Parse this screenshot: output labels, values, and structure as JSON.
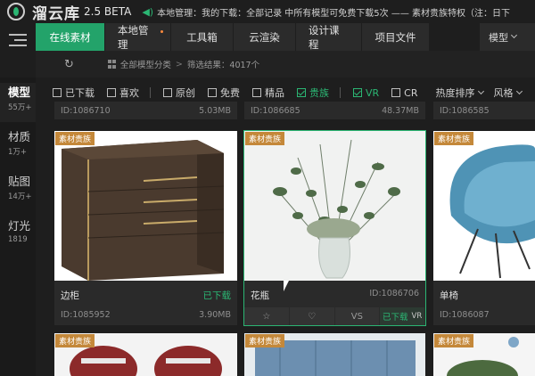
{
  "app": {
    "name": "溜云库",
    "version": "2.5 BETA"
  },
  "notice": "本地管理：我的下载：全部记录 中所有模型可免费下载5次 —— 素材贵族特权（注：日下",
  "tabs": [
    {
      "label": "在线素材",
      "active": true
    },
    {
      "label": "本地管理",
      "dot": true
    },
    {
      "label": "工具箱"
    },
    {
      "label": "云渲染"
    },
    {
      "label": "设计课程"
    },
    {
      "label": "项目文件"
    }
  ],
  "model_select": "模型",
  "crumbs": {
    "category": "全部模型分类",
    "result_label": "筛选结果：",
    "result_count": "4017个"
  },
  "sidebar": [
    {
      "label": "模型",
      "count": "55万+",
      "active": true
    },
    {
      "label": "材质",
      "count": "1万+"
    },
    {
      "label": "贴图",
      "count": "14万+"
    },
    {
      "label": "灯光",
      "count": "1819"
    }
  ],
  "filters": [
    {
      "label": "已下载",
      "checked": false
    },
    {
      "label": "喜欢",
      "checked": false
    },
    {
      "label": "原创",
      "checked": false
    },
    {
      "label": "免费",
      "checked": false
    },
    {
      "label": "精品",
      "checked": false
    },
    {
      "label": "贵族",
      "checked": true
    },
    {
      "label": "VR",
      "checked": true
    },
    {
      "label": "CR",
      "checked": false
    }
  ],
  "sort_label": "热度排序",
  "style_label": "风格",
  "top_row": [
    {
      "id": "ID:1086710",
      "size": "5.03MB"
    },
    {
      "id": "ID:1086685",
      "size": "48.37MB"
    },
    {
      "id": "ID:1086585"
    }
  ],
  "cards": [
    {
      "tag": "素材贵族",
      "name": "边柜",
      "download": "已下载",
      "id": "ID:1085952",
      "size": "3.90MB"
    },
    {
      "tag": "素材贵族",
      "name": "花瓶",
      "id": "ID:1086706",
      "actions": {
        "vs": "VS",
        "downloaded": "已下载",
        "vr": "VR"
      }
    },
    {
      "tag": "素材贵族",
      "name": "单椅",
      "id": "ID:1086087"
    }
  ],
  "bottom_tags": [
    "素材贵族",
    "素材贵族",
    "素材贵族"
  ]
}
